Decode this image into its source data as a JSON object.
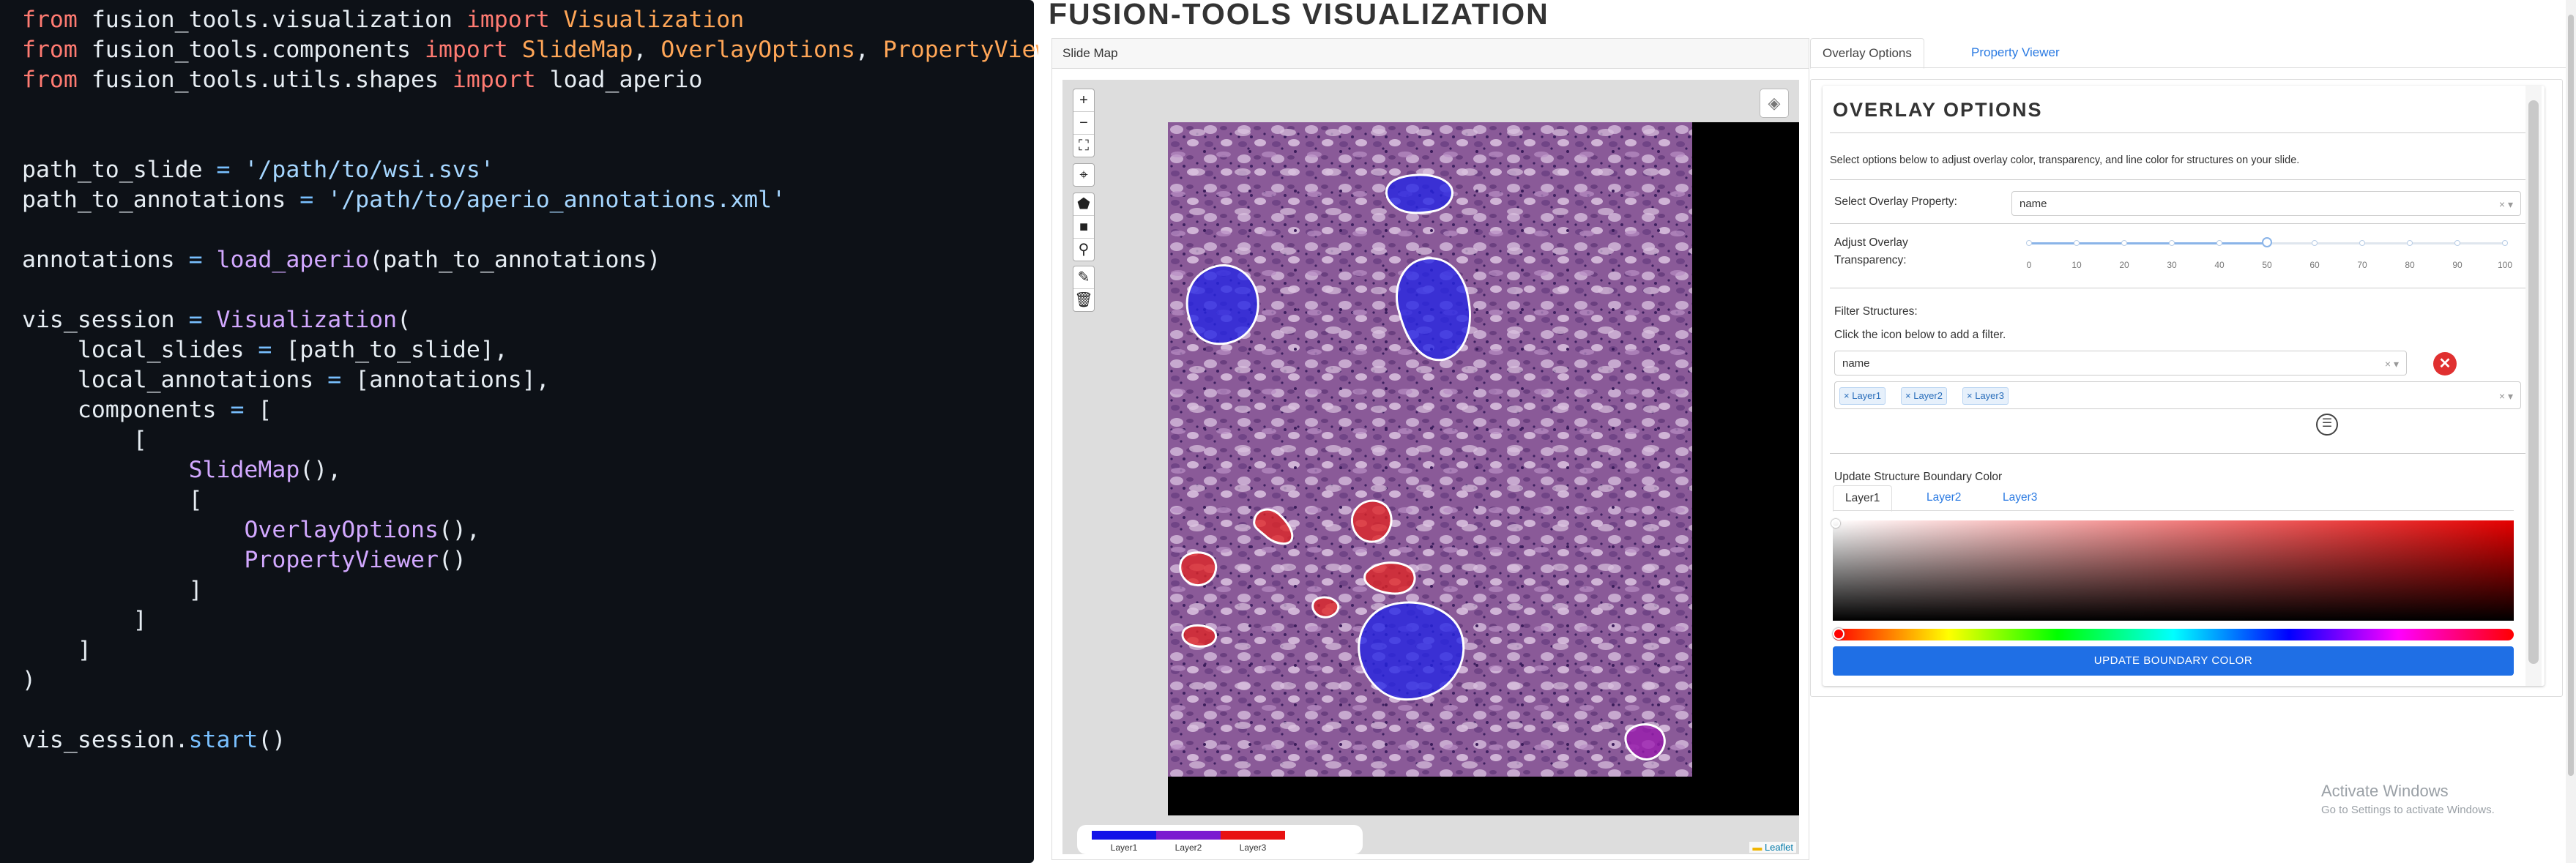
{
  "code": {
    "lines": [
      [
        {
          "t": "from",
          "c": "kw"
        },
        {
          "t": " fusion_tools.visualization "
        },
        {
          "t": "import",
          "c": "kw"
        },
        {
          "t": " "
        },
        {
          "t": "Visualization",
          "c": "cls"
        }
      ],
      [
        {
          "t": "from",
          "c": "kw"
        },
        {
          "t": " fusion_tools.components "
        },
        {
          "t": "import",
          "c": "kw"
        },
        {
          "t": " "
        },
        {
          "t": "SlideMap",
          "c": "cls"
        },
        {
          "t": ", "
        },
        {
          "t": "OverlayOptions",
          "c": "cls"
        },
        {
          "t": ", "
        },
        {
          "t": "PropertyViewer",
          "c": "cls"
        }
      ],
      [
        {
          "t": "from",
          "c": "kw"
        },
        {
          "t": " fusion_tools.utils.shapes "
        },
        {
          "t": "import",
          "c": "kw"
        },
        {
          "t": " load_aperio"
        }
      ],
      [],
      [],
      [
        {
          "t": "path_to_slide "
        },
        {
          "t": "=",
          "c": "op"
        },
        {
          "t": " "
        },
        {
          "t": "'/path/to/wsi.svs'",
          "c": "str"
        }
      ],
      [
        {
          "t": "path_to_annotations "
        },
        {
          "t": "=",
          "c": "op"
        },
        {
          "t": " "
        },
        {
          "t": "'/path/to/aperio_annotations.xml'",
          "c": "str"
        }
      ],
      [],
      [
        {
          "t": "annotations "
        },
        {
          "t": "=",
          "c": "op"
        },
        {
          "t": " "
        },
        {
          "t": "load_aperio",
          "c": "fn"
        },
        {
          "t": "(path_to_annotations)"
        }
      ],
      [],
      [
        {
          "t": "vis_session "
        },
        {
          "t": "=",
          "c": "op"
        },
        {
          "t": " "
        },
        {
          "t": "Visualization",
          "c": "fn"
        },
        {
          "t": "("
        }
      ],
      [
        {
          "t": "    local_slides "
        },
        {
          "t": "=",
          "c": "op"
        },
        {
          "t": " [path_to_slide],"
        }
      ],
      [
        {
          "t": "    local_annotations "
        },
        {
          "t": "=",
          "c": "op"
        },
        {
          "t": " [annotations],"
        }
      ],
      [
        {
          "t": "    components "
        },
        {
          "t": "=",
          "c": "op"
        },
        {
          "t": " ["
        }
      ],
      [
        {
          "t": "        ["
        }
      ],
      [
        {
          "t": "            "
        },
        {
          "t": "SlideMap",
          "c": "fn"
        },
        {
          "t": "(),"
        }
      ],
      [
        {
          "t": "            ["
        }
      ],
      [
        {
          "t": "                "
        },
        {
          "t": "OverlayOptions",
          "c": "fn"
        },
        {
          "t": "(),"
        }
      ],
      [
        {
          "t": "                "
        },
        {
          "t": "PropertyViewer",
          "c": "fn"
        },
        {
          "t": "()"
        }
      ],
      [
        {
          "t": "            ]"
        }
      ],
      [
        {
          "t": "        ]"
        }
      ],
      [
        {
          "t": "    ]"
        }
      ],
      [
        {
          "t": ")"
        }
      ],
      [],
      [
        {
          "t": "vis_session."
        },
        {
          "t": "start",
          "c": "call"
        },
        {
          "t": "()"
        }
      ]
    ]
  },
  "app": {
    "title": "FUSION-TOOLS VISUALIZATION",
    "slide_card_header": "Slide Map",
    "map_controls": {
      "zoom_in": "+",
      "zoom_out": "−",
      "fullscreen": "⛶",
      "locate": "⌖",
      "draw_polygon": "⬟",
      "draw_rect": "■",
      "draw_marker": "⚲",
      "edit": "✎",
      "delete": "🗑"
    },
    "layers_icon": "layers-icon",
    "legend": [
      {
        "label": "Layer1",
        "color": "#1212e8"
      },
      {
        "label": "Layer2",
        "color": "#7b1bd0"
      },
      {
        "label": "Layer3",
        "color": "#e81212"
      }
    ],
    "attribution": "Leaflet",
    "tabs": [
      "Overlay Options",
      "Property Viewer"
    ],
    "overlay": {
      "title": "OVERLAY OPTIONS",
      "description": "Select options below to adjust overlay color, transparency, and line color for structures on your slide.",
      "select_property_label": "Select Overlay Property:",
      "select_property_value": "name",
      "transparency_label_1": "Adjust Overlay",
      "transparency_label_2": "Transparency:",
      "transparency_ticks": [
        "0",
        "10",
        "20",
        "30",
        "40",
        "50",
        "60",
        "70",
        "80",
        "90",
        "100"
      ],
      "transparency_value": 50,
      "filter_label": "Filter Structures:",
      "filter_hint": "Click the icon below to add a filter.",
      "filter_property": "name",
      "filter_chips": [
        "Layer1",
        "Layer2",
        "Layer3"
      ],
      "boundary_label": "Update Structure Boundary Color",
      "color_tabs": [
        "Layer1",
        "Layer2",
        "Layer3"
      ],
      "update_button": "UPDATE BOUNDARY COLOR"
    },
    "watermark": {
      "line1": "Activate Windows",
      "line2": "Go to Settings to activate Windows."
    }
  },
  "annotations": [
    {
      "layer": "Layer1",
      "color": "#2424e6"
    },
    {
      "layer": "Layer3",
      "color": "#e02424"
    },
    {
      "layer": "Layer2",
      "color": "#9b1bb0"
    }
  ]
}
